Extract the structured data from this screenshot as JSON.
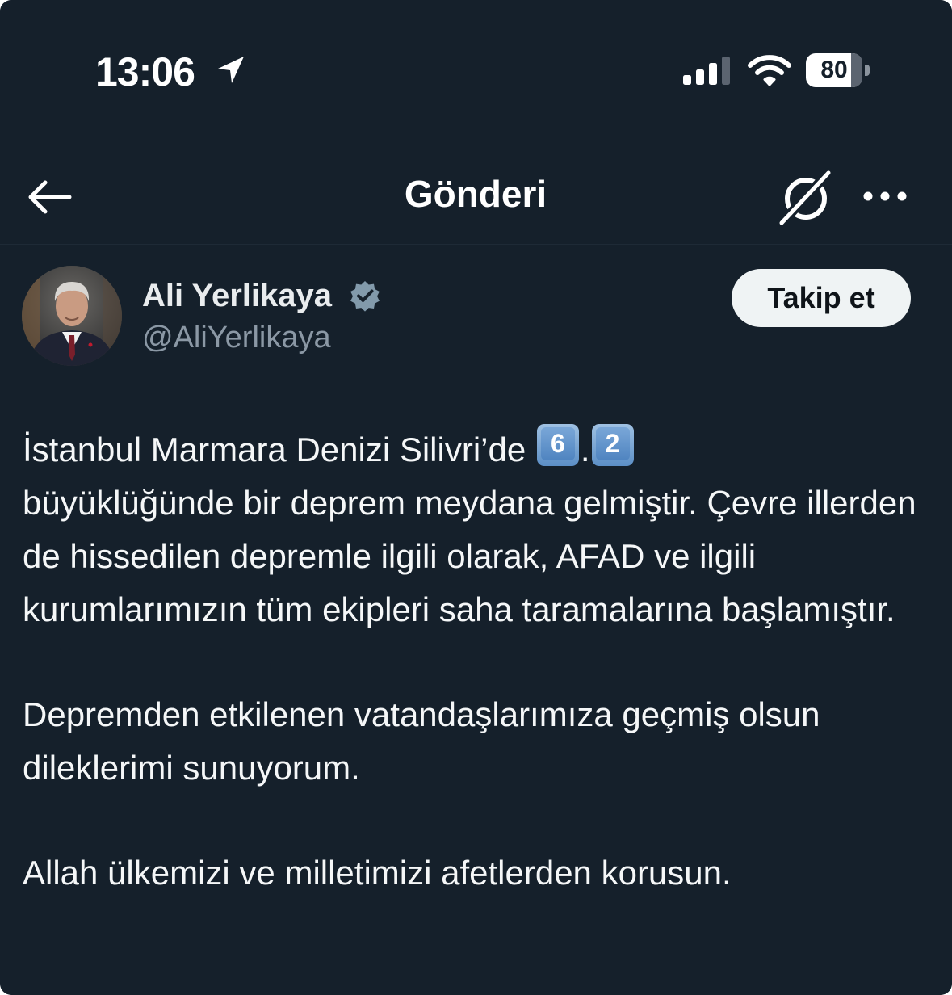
{
  "status_bar": {
    "time": "13:06",
    "battery": "80",
    "battery_level": 0.8
  },
  "header": {
    "title": "Gönderi"
  },
  "author": {
    "name": "Ali Yerlikaya",
    "handle": "@AliYerlikaya",
    "follow_label": "Takip et"
  },
  "post": {
    "line1_text": "İstanbul Marmara Denizi Silivri’de",
    "keycap_1": "6",
    "dot": ".",
    "keycap_2": "2",
    "paragraph1_rest": "büyüklüğünde bir deprem meydana gelmiştir. Çevre illerden de hissedilen depremle ilgili olarak, AFAD ve ilgili kurumlarımızın tüm ekipleri saha taramalarına başlamıştır.",
    "paragraph2": "Depremden etkilenen vatandaşlarımıza geçmiş olsun dileklerimi sunuyorum.",
    "paragraph3": "Allah ülkemizi ve milletimizi afetlerden korusun."
  },
  "colors": {
    "background": "#15202b",
    "handle": "#8b98a5",
    "follow_button_bg": "#eff3f4",
    "verified_badge": "#829aab"
  }
}
